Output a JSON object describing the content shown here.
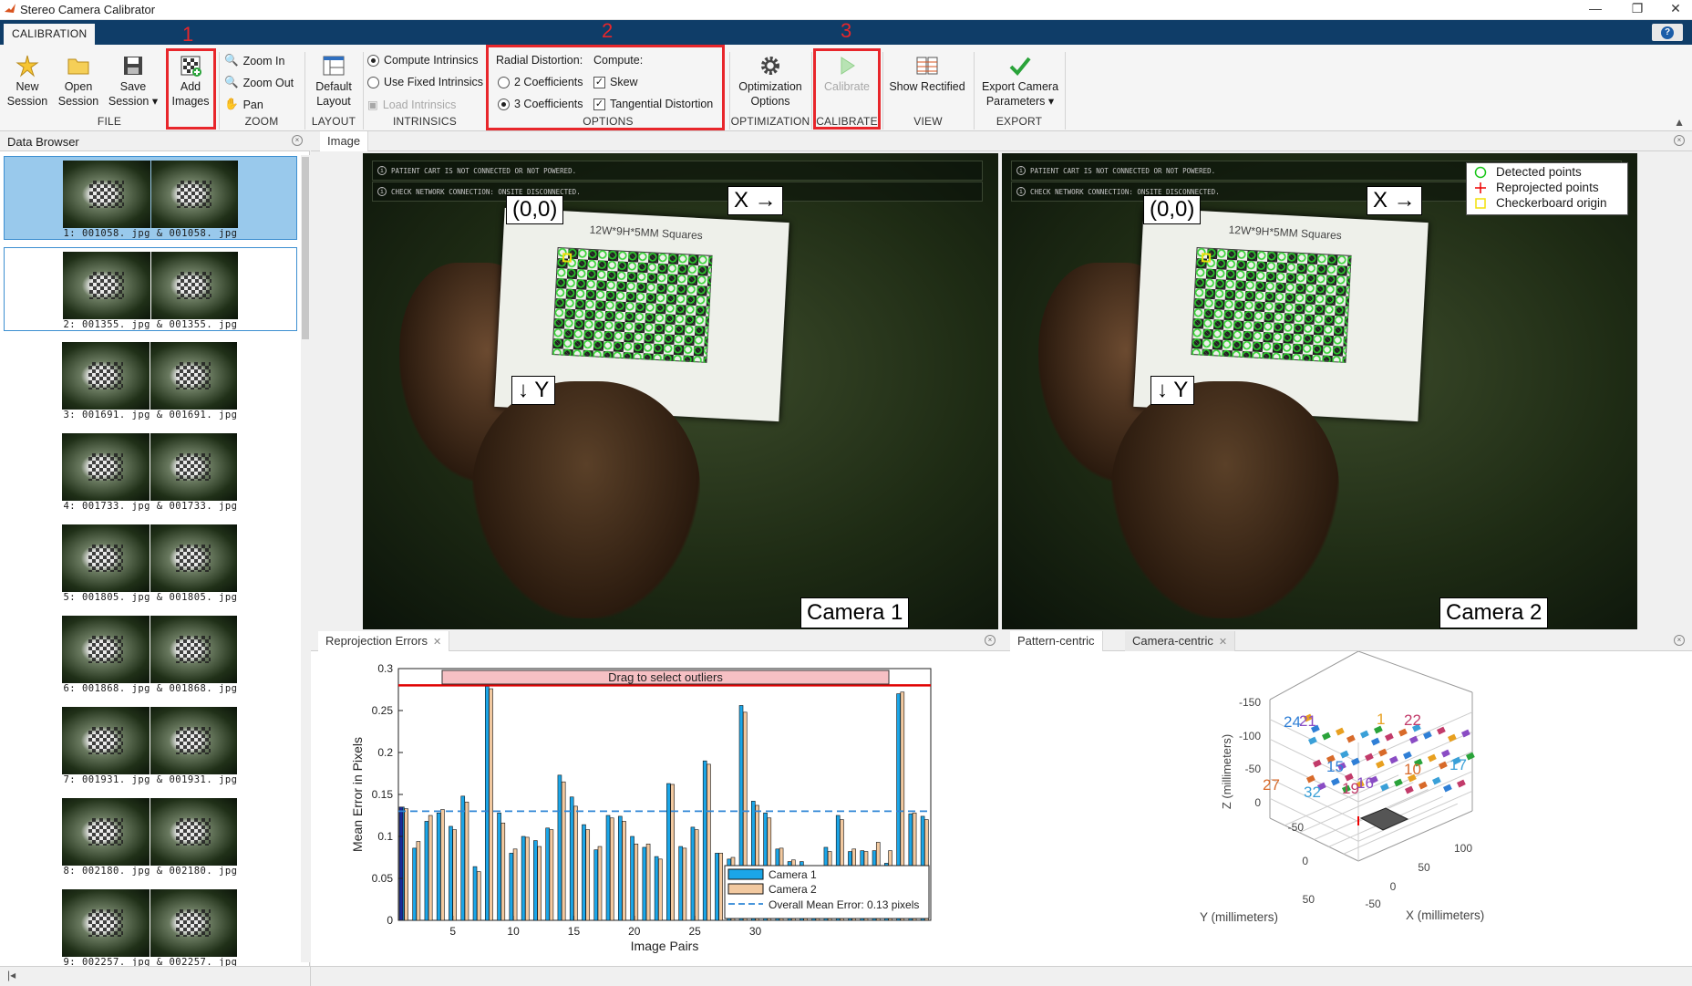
{
  "window": {
    "title": "Stereo Camera Calibrator",
    "minimize": "—",
    "restore": "❐",
    "close": "✕"
  },
  "tabs": {
    "active": "CALIBRATION",
    "help": "?"
  },
  "toolstrip": {
    "file": {
      "new_line1": "New",
      "new_line2": "Session",
      "open_line1": "Open",
      "open_line2": "Session",
      "save_line1": "Save",
      "save_line2": "Session",
      "add_line1": "Add",
      "add_line2": "Images",
      "group": "FILE"
    },
    "zoom": {
      "zoom_in": "Zoom In",
      "zoom_out": "Zoom Out",
      "pan": "Pan",
      "group": "ZOOM"
    },
    "layout": {
      "default_line1": "Default",
      "default_line2": "Layout",
      "group": "LAYOUT"
    },
    "intrinsics": {
      "compute": "Compute Intrinsics",
      "use_fixed": "Use Fixed Intrinsics",
      "load": "Load Intrinsics",
      "group": "INTRINSICS"
    },
    "options": {
      "radial_label": "Radial Distortion:",
      "two_coef": "2 Coefficients",
      "three_coef": "3 Coefficients",
      "compute_label": "Compute:",
      "skew": "Skew",
      "tangential": "Tangential Distortion",
      "group": "OPTIONS"
    },
    "optimization": {
      "line1": "Optimization",
      "line2": "Options",
      "group": "OPTIMIZATION"
    },
    "calibrate": {
      "label": "Calibrate",
      "group": "CALIBRATE"
    },
    "view": {
      "show_rectified": "Show Rectified",
      "group": "VIEW"
    },
    "export": {
      "line1": "Export Camera",
      "line2": "Parameters",
      "group": "EXPORT"
    }
  },
  "annotations": [
    "1",
    "2",
    "3"
  ],
  "data_browser": {
    "title": "Data Browser",
    "items": [
      "1:  001058. jpg  &  001058. jpg",
      "2:  001355. jpg  &  001355. jpg",
      "3:  001691. jpg  &  001691. jpg",
      "4:  001733. jpg  &  001733. jpg",
      "5:  001805. jpg  &  001805. jpg",
      "6:  001868. jpg  &  001868. jpg",
      "7:  001931. jpg  &  001931. jpg",
      "8:  002180. jpg  &  002180. jpg",
      "9:  002257. jpg  &  002257. jpg"
    ]
  },
  "image_panel": {
    "tab": "Image",
    "banner1": "PATIENT CART IS NOT CONNECTED OR NOT POWERED.",
    "banner2": "CHECK NETWORK CONNECTION: ONSITE DISCONNECTED.",
    "origin_label": "(0,0)",
    "x_label": "X →",
    "y_label": "↓ Y",
    "board_text": "12W*9H*5MM  Squares",
    "camera1": "Camera 1",
    "camera2": "Camera 2",
    "legend": [
      "Detected points",
      "Reprojected points",
      "Checkerboard origin"
    ]
  },
  "reprojection": {
    "tab": "Reprojection Errors",
    "drag_label": "Drag to select outliers",
    "legend": [
      "Camera 1",
      "Camera 2",
      "Overall Mean Error: 0.13 pixels"
    ]
  },
  "extrinsics": {
    "tab_active": "Pattern-centric",
    "tab_other": "Camera-centric"
  },
  "chart_data": [
    {
      "type": "bar",
      "xlabel": "Image Pairs",
      "ylabel": "Mean Error in Pixels",
      "ylim": [
        0,
        0.3
      ],
      "xticks": [
        5,
        10,
        15,
        20,
        25,
        30
      ],
      "yticks": [
        0,
        0.05,
        0.1,
        0.15,
        0.2,
        0.25,
        0.3
      ],
      "categories": [
        1,
        2,
        3,
        4,
        5,
        6,
        7,
        8,
        9,
        10,
        11,
        12,
        13,
        14,
        15,
        16,
        17,
        18,
        19,
        20,
        21,
        22,
        23,
        24,
        25,
        26,
        27,
        28,
        29,
        30,
        31,
        32,
        33,
        34
      ],
      "series": [
        {
          "name": "Camera 1",
          "color": "#1ba6e8",
          "values": [
            0.135,
            0.086,
            0.118,
            0.128,
            0.112,
            0.148,
            0.064,
            0.279,
            0.128,
            0.08,
            0.1,
            0.095,
            0.11,
            0.173,
            0.147,
            0.114,
            0.084,
            0.125,
            0.124,
            0.1,
            0.087,
            0.076,
            0.163,
            0.088,
            0.111,
            0.19,
            0.08,
            0.073,
            0.256,
            0.142,
            0.128,
            0.085,
            0.07,
            0.07,
            0.028,
            0.087,
            0.125,
            0.082,
            0.083,
            0.083,
            0.068,
            0.27,
            0.127,
            0.124
          ]
        },
        {
          "name": "Camera 2",
          "color": "#f2c9a0",
          "values": [
            0.133,
            0.094,
            0.125,
            0.132,
            0.108,
            0.141,
            0.058,
            0.276,
            0.116,
            0.085,
            0.099,
            0.088,
            0.108,
            0.165,
            0.136,
            0.108,
            0.088,
            0.122,
            0.118,
            0.091,
            0.091,
            0.073,
            0.162,
            0.086,
            0.108,
            0.186,
            0.08,
            0.075,
            0.248,
            0.137,
            0.122,
            0.086,
            0.072,
            0.063,
            0.04,
            0.082,
            0.12,
            0.085,
            0.082,
            0.093,
            0.083,
            0.272,
            0.128,
            0.12
          ]
        }
      ],
      "reference_lines": [
        {
          "name": "Overall Mean Error",
          "y": 0.13,
          "color": "#2f86d6"
        },
        {
          "name": "outlier threshold",
          "y": 0.28,
          "color": "#e00000"
        }
      ]
    },
    {
      "type": "scatter",
      "title": "",
      "xlabel": "X (millimeters)",
      "ylabel": "Y (millimeters)",
      "zlabel": "Z (millimeters)",
      "z_ticks": [
        "-150",
        "-100",
        "-50",
        "0"
      ],
      "y_ticks": [
        "-50",
        "0",
        "50"
      ],
      "x_ticks": [
        "-50",
        "0",
        "50",
        "100"
      ],
      "labels": [
        {
          "text": "22",
          "color": "#c23b6a"
        },
        {
          "text": "21",
          "color": "#8a4cc4"
        },
        {
          "text": "24",
          "color": "#2f7fd6"
        },
        {
          "text": "1",
          "color": "#e8a020"
        },
        {
          "text": "27",
          "color": "#d86a2a"
        },
        {
          "text": "32",
          "color": "#3aa0d8"
        },
        {
          "text": "17",
          "color": "#3aa0d8"
        },
        {
          "text": "19",
          "color": "#c23b6a"
        },
        {
          "text": "10",
          "color": "#d86a2a"
        },
        {
          "text": "16",
          "color": "#8a4cc4"
        },
        {
          "text": "15",
          "color": "#2f7fd6"
        }
      ]
    }
  ]
}
